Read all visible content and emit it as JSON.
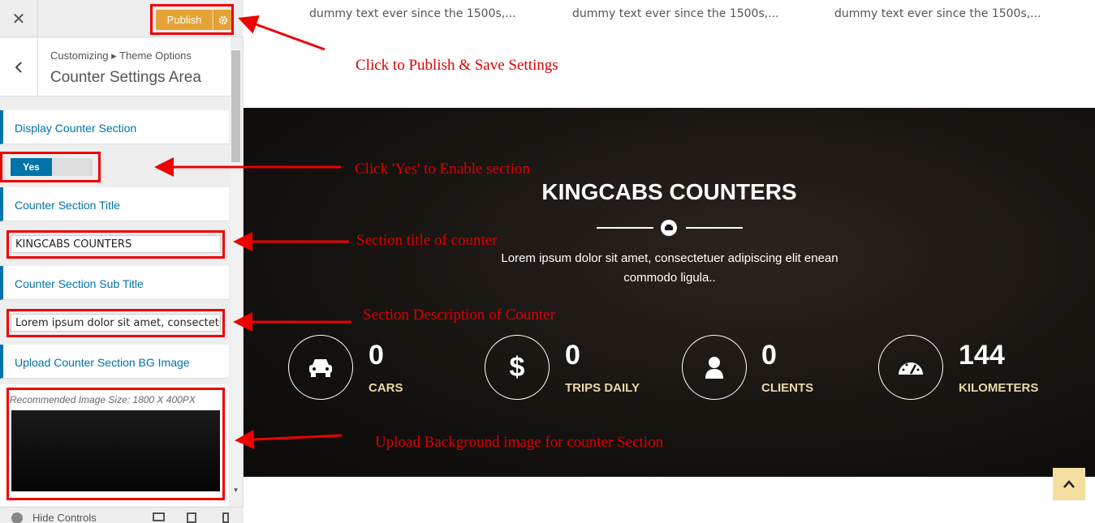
{
  "sidebar": {
    "close_label": "✕",
    "publish_label": "Publish",
    "breadcrumb": "Customizing ▸ Theme Options",
    "panel_title": "Counter Settings Area",
    "sections": {
      "display": "Display Counter Section",
      "title": "Counter Section Title",
      "subtitle": "Counter Section Sub Title",
      "bg_image": "Upload Counter Section BG Image"
    },
    "toggle_label": "Yes",
    "title_value": "KINGCABS COUNTERS",
    "subtitle_value": "Lorem ipsum dolor sit amet, consectetuer adipiscing elit enean commodo ligula..",
    "image_hint": "Recommended Image Size: 1800 X 400PX",
    "hide_controls": "Hide Controls"
  },
  "preview": {
    "dummy_texts": [
      "dummy text ever since the 1500s,...",
      "dummy text ever since the 1500s,...",
      "dummy text ever since the 1500s,..."
    ],
    "counter_title": "KINGCABS COUNTERS",
    "counter_subtitle": "Lorem ipsum dolor sit amet, consectetuer adipiscing elit enean commodo ligula..",
    "stats": [
      {
        "icon": "car-icon",
        "value": "0",
        "label": "CARS"
      },
      {
        "icon": "dollar-icon",
        "value": "0",
        "label": "TRIPS DAILY"
      },
      {
        "icon": "user-icon",
        "value": "0",
        "label": "CLIENTS"
      },
      {
        "icon": "speedometer-icon",
        "value": "144",
        "label": "KILOMETERS"
      }
    ]
  },
  "annotations": {
    "publish": "Click to Publish & Save Settings",
    "enable": "Click 'Yes' to Enable section",
    "title": "Section title of counter",
    "description": "Section Description of Counter",
    "upload": "Upload Background image for counter Section"
  },
  "colors": {
    "accent": "#0073aa",
    "publish": "#e5a336",
    "annotation": "#dd0000",
    "stat_label": "#e8d9a8"
  }
}
